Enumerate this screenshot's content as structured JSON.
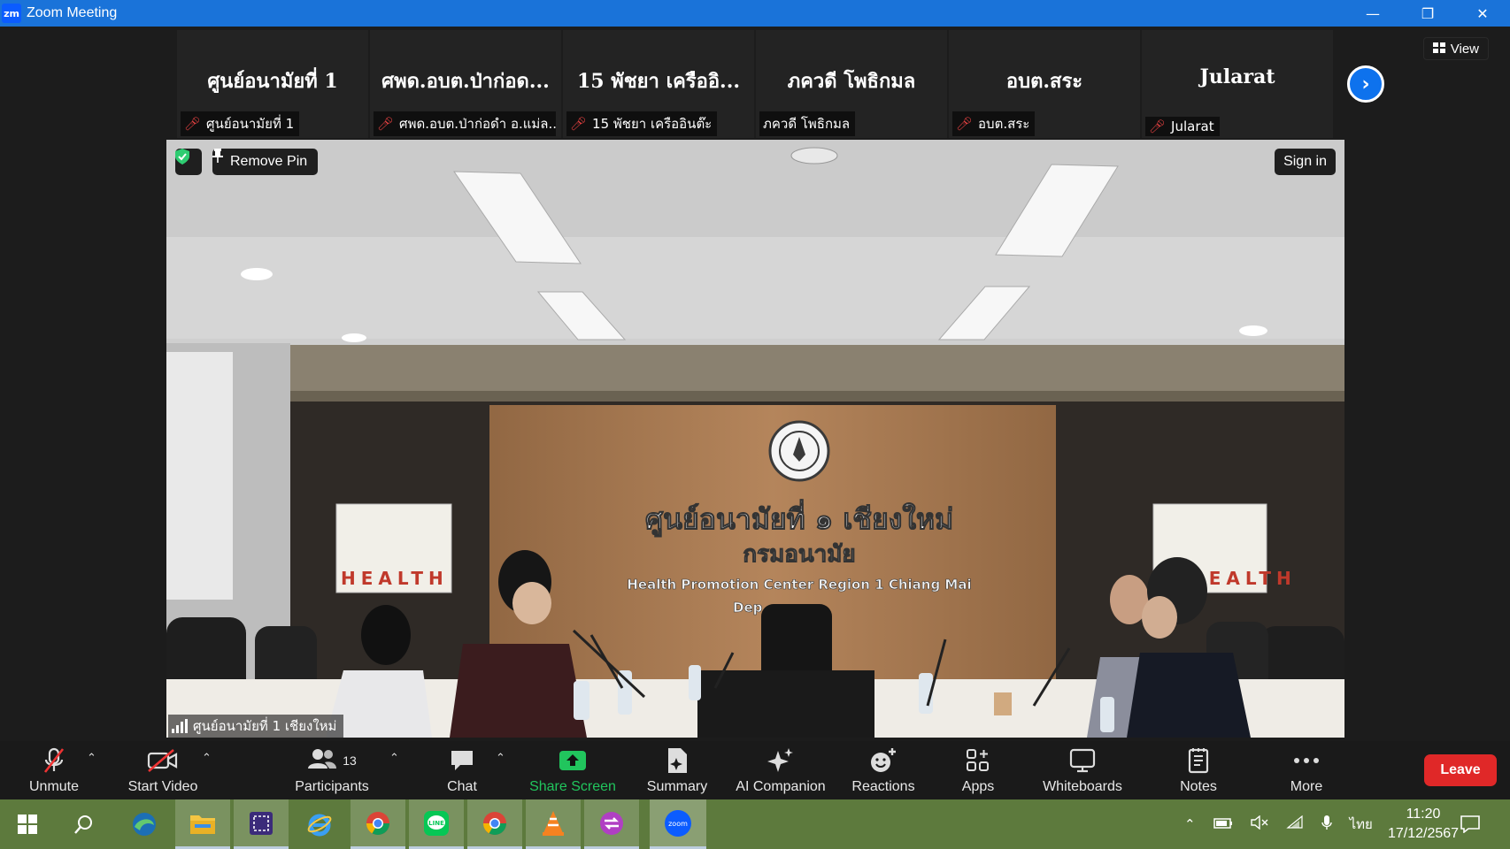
{
  "window": {
    "title": "Zoom Meeting",
    "app_icon": "zm"
  },
  "view_button": {
    "label": "View"
  },
  "participants_strip": [
    {
      "display_name": "ศูนย์อนามัยที่ 1",
      "label": "ศูนย์อนามัยที่ 1",
      "muted": true
    },
    {
      "display_name": "ศพด.อบต.ป่าก่อด...",
      "label": "ศพด.อบต.ป่าก่อดำ อ.แม่ล...",
      "muted": true
    },
    {
      "display_name": "15 พัชยา เครืออิ...",
      "label": "15 พัชยา เครืออินต๊ะ",
      "muted": true
    },
    {
      "display_name": "ภควดี  โพธิกมล",
      "label": "ภควดี  โพธิกมล",
      "muted": false
    },
    {
      "display_name": "อบต.สระ",
      "label": "อบต.สระ",
      "muted": true
    },
    {
      "display_name": "Jularat",
      "label": "Jularat",
      "muted": true
    }
  ],
  "main_video": {
    "remove_pin_label": "Remove Pin",
    "sign_in_label": "Sign in",
    "speaker_label": "ศูนย์อนามัยที่ 1 เชียงใหม่",
    "wall_text_line1": "ศูนย์อนามัยที่ ๑ เชียงใหม่",
    "wall_text_line2": "กรมอนามัย",
    "wall_text_line3": "Health Promotion Center Region 1 Chiang Mai",
    "wall_text_line4": "Dep",
    "poster_text": "HEALTH"
  },
  "toolbar": {
    "unmute": "Unmute",
    "start_video": "Start Video",
    "participants": "Participants",
    "participants_count": "13",
    "chat": "Chat",
    "share_screen": "Share Screen",
    "summary": "Summary",
    "ai_companion": "AI Companion",
    "reactions": "Reactions",
    "apps": "Apps",
    "whiteboards": "Whiteboards",
    "notes": "Notes",
    "more": "More",
    "leave": "Leave"
  },
  "taskbar": {
    "apps": [
      "windows-start",
      "search",
      "edge-beta",
      "file-explorer",
      "snip-tool",
      "internet-explorer",
      "chrome",
      "line",
      "chrome",
      "vlc",
      "pdf-tool",
      "zoom"
    ],
    "language": "ไทย",
    "time": "11:20",
    "date": "17/12/2567"
  },
  "colors": {
    "title_bar": "#1a73d9",
    "accent_blue": "#0e72ed",
    "leave_red": "#e02828",
    "share_green": "#21c55d",
    "taskbar": "#5d7a3d"
  }
}
